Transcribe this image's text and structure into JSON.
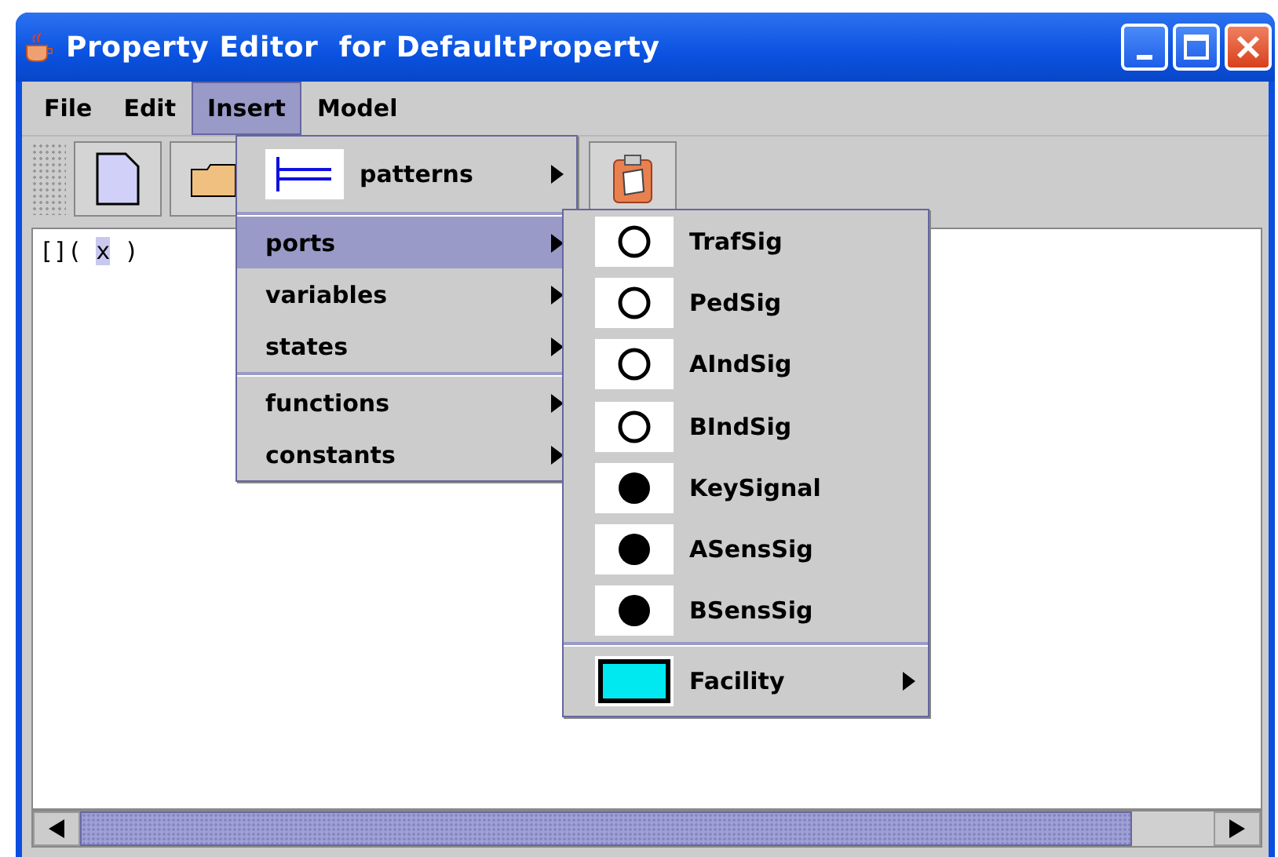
{
  "window": {
    "title": "Property Editor  for DefaultProperty"
  },
  "menubar": [
    {
      "label": "File",
      "selected": false
    },
    {
      "label": "Edit",
      "selected": false
    },
    {
      "label": "Insert",
      "selected": true
    },
    {
      "label": "Model",
      "selected": false
    }
  ],
  "toolbar": [
    {
      "kind": "new"
    },
    {
      "kind": "open"
    },
    {
      "kind": "paste"
    }
  ],
  "editor": {
    "before": "[](",
    "selection": "x",
    "after": ")"
  },
  "insert_menu": {
    "groups": [
      [
        {
          "label": "patterns",
          "kind": "patterns",
          "selected": false
        }
      ],
      [
        {
          "label": "ports",
          "kind": "plain",
          "selected": true
        },
        {
          "label": "variables",
          "kind": "plain",
          "selected": false
        },
        {
          "label": "states",
          "kind": "plain",
          "selected": false
        }
      ],
      [
        {
          "label": "functions",
          "kind": "plain",
          "selected": false
        },
        {
          "label": "constants",
          "kind": "plain",
          "selected": false
        }
      ]
    ]
  },
  "ports_submenu": {
    "groups": [
      [
        {
          "label": "TrafSig",
          "kind": "hollow"
        },
        {
          "label": "PedSig",
          "kind": "hollow"
        },
        {
          "label": "AIndSig",
          "kind": "hollow"
        },
        {
          "label": "BIndSig",
          "kind": "hollow"
        },
        {
          "label": "KeySignal",
          "kind": "filled"
        },
        {
          "label": "ASensSig",
          "kind": "filled"
        },
        {
          "label": "BSensSig",
          "kind": "filled"
        }
      ],
      [
        {
          "label": "Facility",
          "kind": "facility"
        }
      ]
    ]
  }
}
